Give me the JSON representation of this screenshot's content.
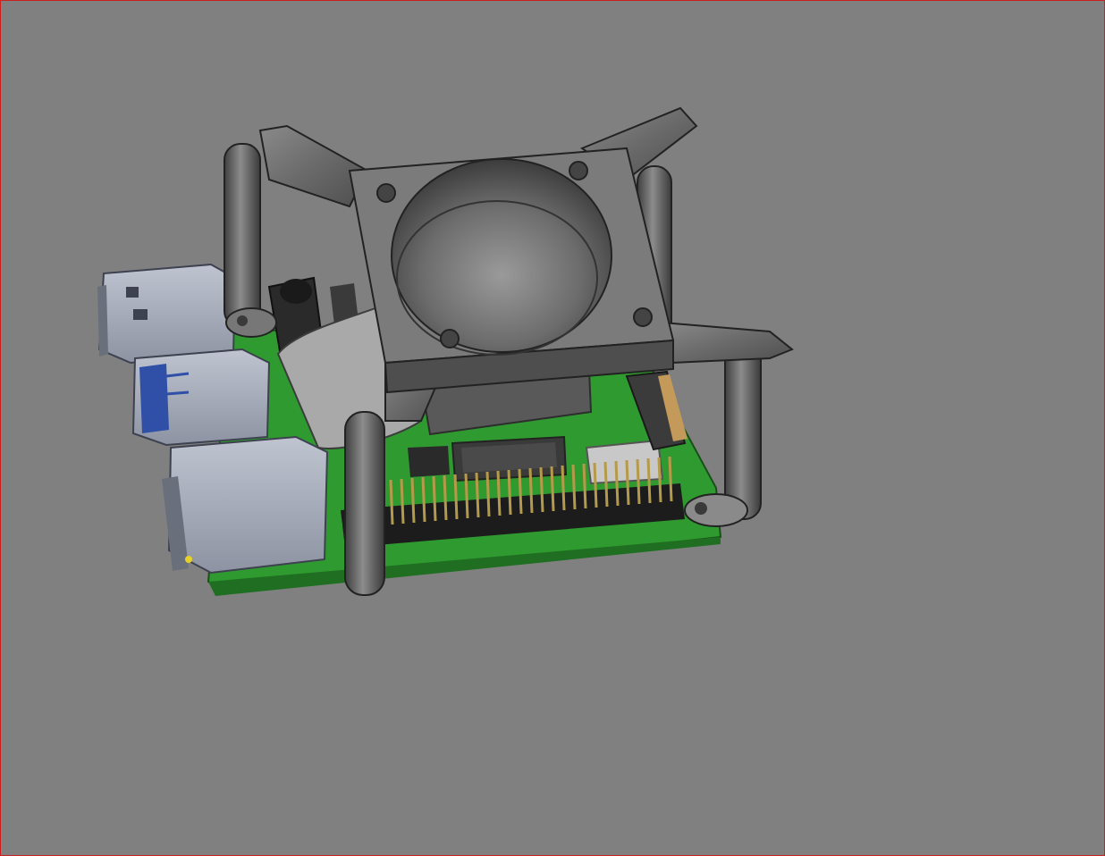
{
  "viewport": {
    "background": "#808080",
    "border_color": "#cc2020",
    "model": "raspberry-pi-board-with-fan-mount"
  },
  "colors": {
    "pcb": "#2f9a2f",
    "pcb_dark": "#1f6e22",
    "metal_port": "#a7acba",
    "mount": "#6e6e6e",
    "mount_dark": "#4e4e4e",
    "usb3_blue": "#3050a8",
    "pin_gold": "#b59a4a",
    "header_black": "#1c1c1c"
  },
  "icons": [
    "usb-port-icon",
    "ethernet-port-icon",
    "gpio-header-icon",
    "fan-duct-icon"
  ]
}
